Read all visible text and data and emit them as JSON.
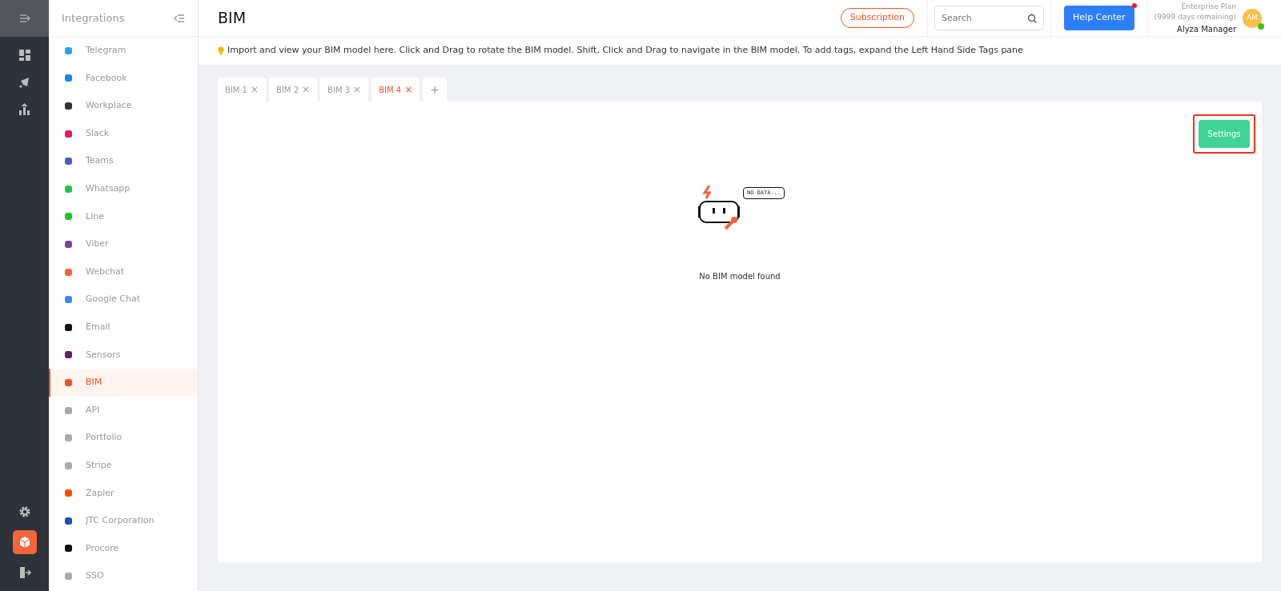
{
  "rail": {
    "top_items": [
      {
        "kind": "dashboard",
        "selected": false
      },
      {
        "kind": "megaphone",
        "selected": false
      },
      {
        "kind": "chart",
        "selected": false
      }
    ],
    "bottom_items": [
      {
        "kind": "gear",
        "selected": false
      },
      {
        "kind": "cube",
        "selected": true
      },
      {
        "kind": "logout",
        "selected": false
      }
    ]
  },
  "sidebar": {
    "title": "Integrations",
    "items": [
      {
        "label": "Telegram",
        "color": "#2aa3e8",
        "selected": false
      },
      {
        "label": "Facebook",
        "color": "#1a86f0",
        "selected": false
      },
      {
        "label": "Workplace",
        "color": "#333333",
        "selected": false
      },
      {
        "label": "Slack",
        "color": "#e01e5a",
        "selected": false
      },
      {
        "label": "Teams",
        "color": "#5059c9",
        "selected": false
      },
      {
        "label": "Whatsapp",
        "color": "#25c24a",
        "selected": false
      },
      {
        "label": "Line",
        "color": "#22c12e",
        "selected": false
      },
      {
        "label": "Viber",
        "color": "#7b3fa0",
        "selected": false
      },
      {
        "label": "Webchat",
        "color": "#f26440",
        "selected": false
      },
      {
        "label": "Google Chat",
        "color": "#4285f4",
        "selected": false
      },
      {
        "label": "Email",
        "color": "#111111",
        "selected": false
      },
      {
        "label": "Sensors",
        "color": "#6a1b6e",
        "selected": false
      },
      {
        "label": "BIM",
        "color": "#f4511e",
        "selected": true
      },
      {
        "label": "API",
        "color": "#aaaaaa",
        "selected": false
      },
      {
        "label": "Portfolio",
        "color": "#aaaaaa",
        "selected": false
      },
      {
        "label": "Stripe",
        "color": "#aaaaaa",
        "selected": false
      },
      {
        "label": "Zapier",
        "color": "#ff4a00",
        "selected": false
      },
      {
        "label": "JTC Corporation",
        "color": "#1d4fb8",
        "selected": false
      },
      {
        "label": "Procore",
        "color": "#111111",
        "selected": false
      },
      {
        "label": "SSO",
        "color": "#aaaaaa",
        "selected": false
      }
    ]
  },
  "header": {
    "title": "BIM",
    "subscription": "Subscription",
    "search": {
      "placeholder": "Search"
    },
    "help": "Help Center",
    "help_notification": true,
    "plan": "Enterprise Plan",
    "days": "(9999 days remaining)",
    "user": "Alyza Manager",
    "avatar": "AM",
    "online": true
  },
  "info": "Import and view your BIM model here. Click and Drag to rotate the BIM model. Shift, Click and Drag to navigate in the BIM model. To add tags, expand the Left Hand Side Tags pane",
  "tabs": [
    {
      "label": "BIM 1",
      "selected": false
    },
    {
      "label": "BIM 2",
      "selected": false
    },
    {
      "label": "BIM 3",
      "selected": false
    },
    {
      "label": "BIM 4",
      "selected": true
    }
  ],
  "add_tab": "+",
  "close_mark": "×",
  "settings": {
    "label": "Settings",
    "highlighted": true
  },
  "empty": {
    "bubble": "NO DATA...",
    "message": "No BIM model found"
  }
}
